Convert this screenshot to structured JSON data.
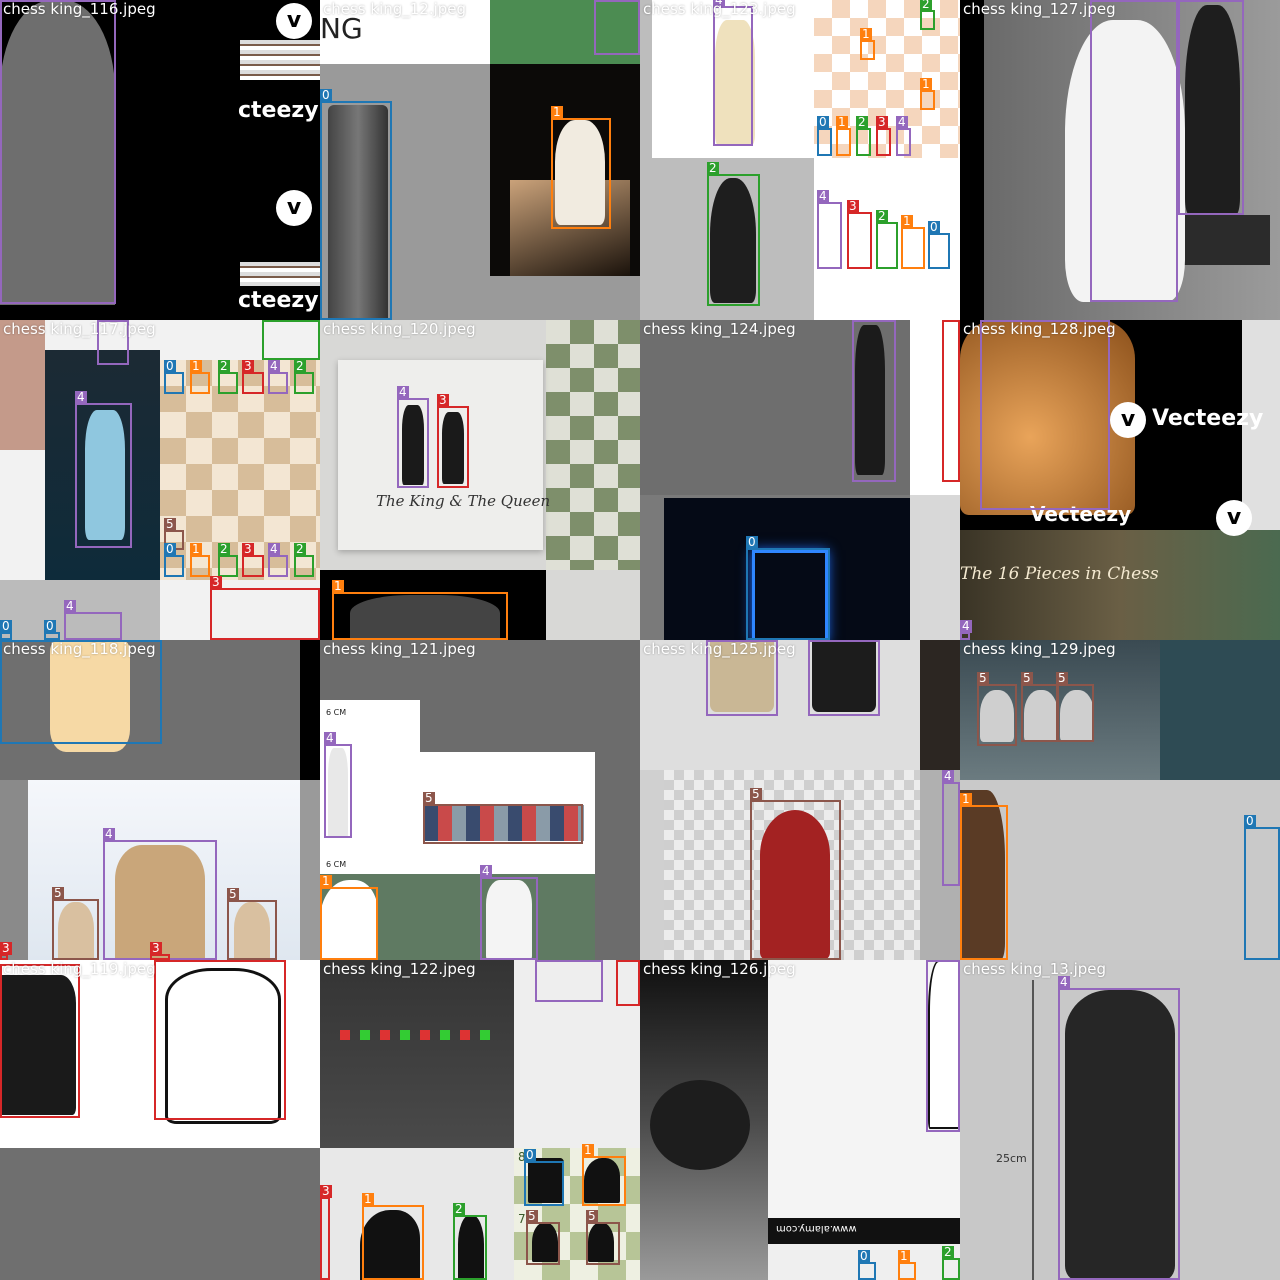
{
  "colors": {
    "class_0": "#1f77b4",
    "class_1": "#ff7f0e",
    "class_2": "#2ca02c",
    "class_3": "#d62728",
    "class_4": "#9467bd",
    "class_5": "#8c564b"
  },
  "tiles": [
    {
      "caption": "chess king_116.jpeg",
      "texts": [
        "cteezy",
        "cteezy"
      ],
      "icons": [
        "vecteezy-logo-icon",
        "king-piece-icon"
      ]
    },
    {
      "caption": "chess king_12.jpeg",
      "texts": [
        "NG"
      ],
      "icons": [
        "rook-piece-icon",
        "knight-piece-icon"
      ]
    },
    {
      "caption": "chess king_123.jpeg",
      "texts": [],
      "icons": [
        "king-piece-icon",
        "bishop-piece-icon",
        "chessboard-icon"
      ]
    },
    {
      "caption": "chess king_127.jpeg",
      "texts": [],
      "icons": [
        "king-piece-icon"
      ]
    },
    {
      "caption": "chess king_117.jpeg",
      "texts": [],
      "icons": [
        "king-piece-icon",
        "chessboard-icon"
      ]
    },
    {
      "caption": "chess king_120.jpeg",
      "texts": [
        "The King & The Queen"
      ],
      "icons": [
        "king-piece-icon",
        "queen-piece-icon",
        "chessboard-icon"
      ]
    },
    {
      "caption": "chess king_124.jpeg",
      "texts": [],
      "icons": [
        "king-piece-icon",
        "rook-piece-icon"
      ]
    },
    {
      "caption": "chess king_128.jpeg",
      "texts": [
        "Vecteezy",
        "Vecteezy",
        "The 16 Pieces in Chess"
      ],
      "icons": [
        "vecteezy-logo-icon"
      ]
    },
    {
      "caption": "chess king_118.jpeg",
      "texts": [],
      "icons": [
        "king-piece-icon",
        "pawn-piece-icon"
      ]
    },
    {
      "caption": "chess king_121.jpeg",
      "texts": [
        "6 CM",
        "6 CM"
      ],
      "icons": [
        "king-piece-icon",
        "pawn-piece-icon",
        "knight-piece-icon"
      ]
    },
    {
      "caption": "chess king_125.jpeg",
      "texts": [],
      "icons": [
        "king-piece-icon",
        "pawn-piece-icon"
      ]
    },
    {
      "caption": "chess king_129.jpeg",
      "texts": [],
      "icons": [
        "pawn-piece-icon",
        "knight-piece-icon"
      ]
    },
    {
      "caption": "chess king_119.jpeg",
      "texts": [],
      "icons": [
        "queen-piece-icon"
      ]
    },
    {
      "caption": "chess king_122.jpeg",
      "texts": [
        "8",
        "7"
      ],
      "icons": [
        "knight-piece-icon",
        "bishop-piece-icon",
        "rook-piece-icon",
        "pawn-piece-icon"
      ]
    },
    {
      "caption": "chess king_126.jpeg",
      "texts": [
        "www.alamy.com"
      ],
      "icons": [
        "king-piece-icon"
      ]
    },
    {
      "caption": "chess king_13.jpeg",
      "texts": [
        "25cm"
      ],
      "icons": [
        "king-piece-icon"
      ]
    }
  ],
  "boxes": [
    {
      "tile": 0,
      "cls": "4"
    },
    {
      "tile": 1,
      "cls": "0"
    },
    {
      "tile": 1,
      "cls": "1"
    },
    {
      "tile": 2,
      "cls": "4"
    },
    {
      "tile": 2,
      "cls": "2"
    },
    {
      "tile": 2,
      "cls": "4"
    },
    {
      "tile": 2,
      "cls": "3"
    },
    {
      "tile": 2,
      "cls": "2"
    },
    {
      "tile": 2,
      "cls": "1"
    },
    {
      "tile": 2,
      "cls": "0"
    },
    {
      "tile": 2,
      "cls": "0"
    },
    {
      "tile": 2,
      "cls": "1"
    },
    {
      "tile": 2,
      "cls": "2"
    },
    {
      "tile": 2,
      "cls": "3"
    },
    {
      "tile": 2,
      "cls": "4"
    },
    {
      "tile": 2,
      "cls": "2"
    },
    {
      "tile": 2,
      "cls": "1"
    },
    {
      "tile": 2,
      "cls": "1"
    },
    {
      "tile": 3,
      "cls": "4"
    },
    {
      "tile": 3,
      "cls": "4"
    },
    {
      "tile": 4,
      "cls": "4"
    },
    {
      "tile": 4,
      "cls": "4"
    },
    {
      "tile": 4,
      "cls": "2"
    },
    {
      "tile": 4,
      "cls": "0"
    },
    {
      "tile": 4,
      "cls": "1"
    },
    {
      "tile": 4,
      "cls": "2"
    },
    {
      "tile": 4,
      "cls": "3"
    },
    {
      "tile": 4,
      "cls": "4"
    },
    {
      "tile": 4,
      "cls": "2"
    },
    {
      "tile": 4,
      "cls": "5"
    },
    {
      "tile": 4,
      "cls": "0"
    },
    {
      "tile": 4,
      "cls": "1"
    },
    {
      "tile": 4,
      "cls": "2"
    },
    {
      "tile": 4,
      "cls": "3"
    },
    {
      "tile": 4,
      "cls": "4"
    },
    {
      "tile": 4,
      "cls": "2"
    },
    {
      "tile": 4,
      "cls": "4"
    },
    {
      "tile": 4,
      "cls": "3"
    },
    {
      "tile": 4,
      "cls": "0"
    },
    {
      "tile": 4,
      "cls": "0"
    },
    {
      "tile": 5,
      "cls": "4"
    },
    {
      "tile": 5,
      "cls": "3"
    },
    {
      "tile": 5,
      "cls": "1"
    },
    {
      "tile": 6,
      "cls": "4"
    },
    {
      "tile": 6,
      "cls": "3"
    },
    {
      "tile": 6,
      "cls": "0"
    },
    {
      "tile": 7,
      "cls": "4"
    },
    {
      "tile": 7,
      "cls": "4"
    },
    {
      "tile": 8,
      "cls": "0"
    },
    {
      "tile": 8,
      "cls": "4"
    },
    {
      "tile": 8,
      "cls": "5"
    },
    {
      "tile": 8,
      "cls": "5"
    },
    {
      "tile": 8,
      "cls": "3"
    },
    {
      "tile": 8,
      "cls": "3"
    },
    {
      "tile": 9,
      "cls": "4"
    },
    {
      "tile": 9,
      "cls": "5"
    },
    {
      "tile": 9,
      "cls": "1"
    },
    {
      "tile": 9,
      "cls": "4"
    },
    {
      "tile": 10,
      "cls": "4"
    },
    {
      "tile": 10,
      "cls": "4"
    },
    {
      "tile": 10,
      "cls": "5"
    },
    {
      "tile": 10,
      "cls": "4"
    },
    {
      "tile": 11,
      "cls": "5"
    },
    {
      "tile": 11,
      "cls": "5"
    },
    {
      "tile": 11,
      "cls": "5"
    },
    {
      "tile": 11,
      "cls": "1"
    },
    {
      "tile": 11,
      "cls": "0"
    },
    {
      "tile": 12,
      "cls": "3"
    },
    {
      "tile": 12,
      "cls": "3"
    },
    {
      "tile": 13,
      "cls": "4"
    },
    {
      "tile": 13,
      "cls": "3"
    },
    {
      "tile": 13,
      "cls": "3"
    },
    {
      "tile": 13,
      "cls": "1"
    },
    {
      "tile": 13,
      "cls": "2"
    },
    {
      "tile": 13,
      "cls": "0"
    },
    {
      "tile": 13,
      "cls": "1"
    },
    {
      "tile": 13,
      "cls": "5"
    },
    {
      "tile": 13,
      "cls": "5"
    },
    {
      "tile": 14,
      "cls": "4"
    },
    {
      "tile": 14,
      "cls": "0"
    },
    {
      "tile": 14,
      "cls": "1"
    },
    {
      "tile": 14,
      "cls": "2"
    },
    {
      "tile": 15,
      "cls": "4"
    }
  ]
}
